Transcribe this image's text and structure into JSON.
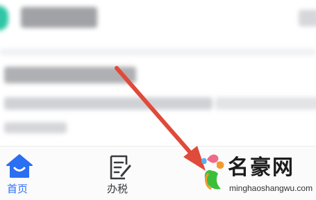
{
  "tabbar": {
    "home_label": "首页",
    "tax_label": "办税"
  },
  "colors": {
    "accent": "#2b6ff3",
    "brand_green": "#2fc6a4",
    "arrow": "#e04a3a"
  },
  "icons": {
    "home": "home-icon",
    "tax": "document-edit-icon"
  },
  "watermark": {
    "text": "名豪网",
    "url": "minghaoshangwu.com"
  }
}
